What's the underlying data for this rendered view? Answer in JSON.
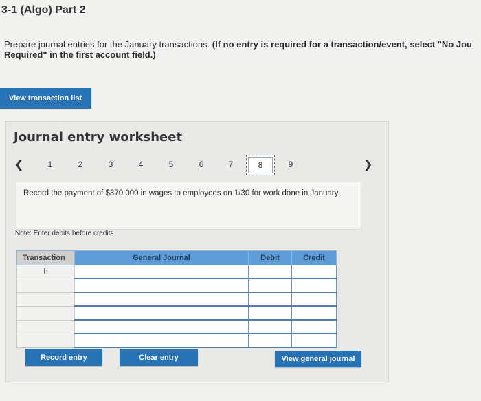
{
  "page": {
    "title": "3-1 (Algo) Part 2",
    "instructions_plain": "Prepare journal entries for the January transactions. ",
    "instructions_bold": "(If no entry is required for a transaction/event, select \"No Jou",
    "instructions_bold_line2": "Required\" in the first account field.)"
  },
  "buttons": {
    "view_transaction_list": "View transaction list",
    "record_entry": "Record entry",
    "clear_entry": "Clear entry",
    "view_general_journal": "View general journal"
  },
  "worksheet": {
    "title": "Journal entry worksheet",
    "steps": [
      "1",
      "2",
      "3",
      "4",
      "5",
      "6",
      "7",
      "8",
      "9"
    ],
    "active_step": "8",
    "transaction_text": "Record the payment of $370,000 in wages to employees on 1/30 for work done in January.",
    "note": "Note: Enter debits before credits.",
    "table": {
      "headers": {
        "transaction": "Transaction",
        "general_journal": "General Journal",
        "debit": "Debit",
        "credit": "Credit"
      },
      "transaction_label": "h"
    }
  },
  "colors": {
    "accent": "#2873b5",
    "table_header": "#5d9cd6"
  }
}
